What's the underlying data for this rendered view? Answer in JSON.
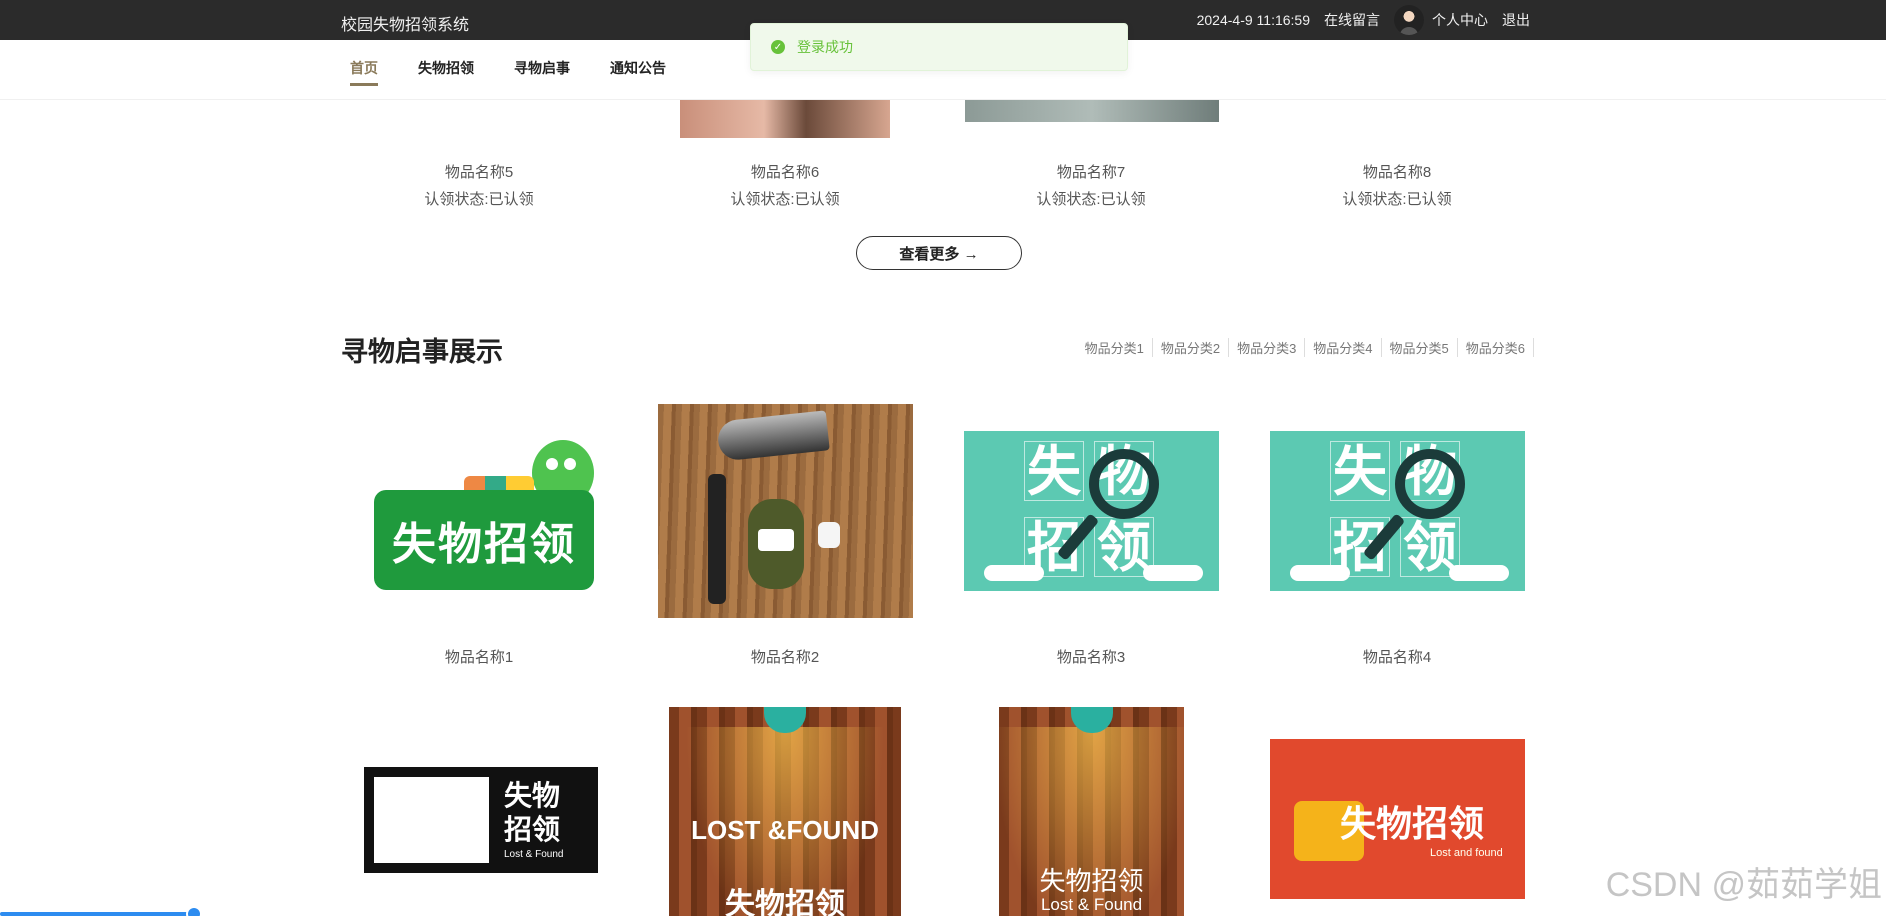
{
  "header": {
    "site_title": "校园失物招领系统",
    "datetime": "2024-4-9 11:16:59",
    "message_link": "在线留言",
    "profile_link": "个人中心",
    "logout_link": "退出"
  },
  "nav": {
    "items": [
      {
        "label": "首页",
        "active": true
      },
      {
        "label": "失物招领"
      },
      {
        "label": "寻物启事"
      },
      {
        "label": "通知公告"
      }
    ]
  },
  "toast": {
    "message": "登录成功"
  },
  "claim_items": [
    {
      "name": "物品名称5",
      "status": "认领状态:已认领"
    },
    {
      "name": "物品名称6",
      "status": "认领状态:已认领"
    },
    {
      "name": "物品名称7",
      "status": "认领状态:已认领"
    },
    {
      "name": "物品名称8",
      "status": "认领状态:已认领"
    }
  ],
  "more_button": "查看更多 →",
  "search_section": {
    "title": "寻物启事展示",
    "categories": [
      "物品分类1",
      "物品分类2",
      "物品分类3",
      "物品分类4",
      "物品分类5",
      "物品分类6"
    ],
    "items": [
      {
        "name": "物品名称1"
      },
      {
        "name": "物品名称2"
      },
      {
        "name": "物品名称3"
      },
      {
        "name": "物品名称4"
      }
    ]
  },
  "images": {
    "green_text": "失物招领",
    "teal_chars": [
      "失",
      "物",
      "招",
      "领"
    ],
    "bw_text_1": "失物",
    "bw_text_2": "招领",
    "bw_small": "Lost & Found",
    "wood1_en": "LOST &FOUND",
    "wood1_cn": "失物招领",
    "wood2_cn": "失物招领",
    "wood2_en": "Lost & Found",
    "red_text": "失物招领",
    "red_sub": "Lost and found"
  },
  "watermark": "CSDN @茹茹学姐"
}
